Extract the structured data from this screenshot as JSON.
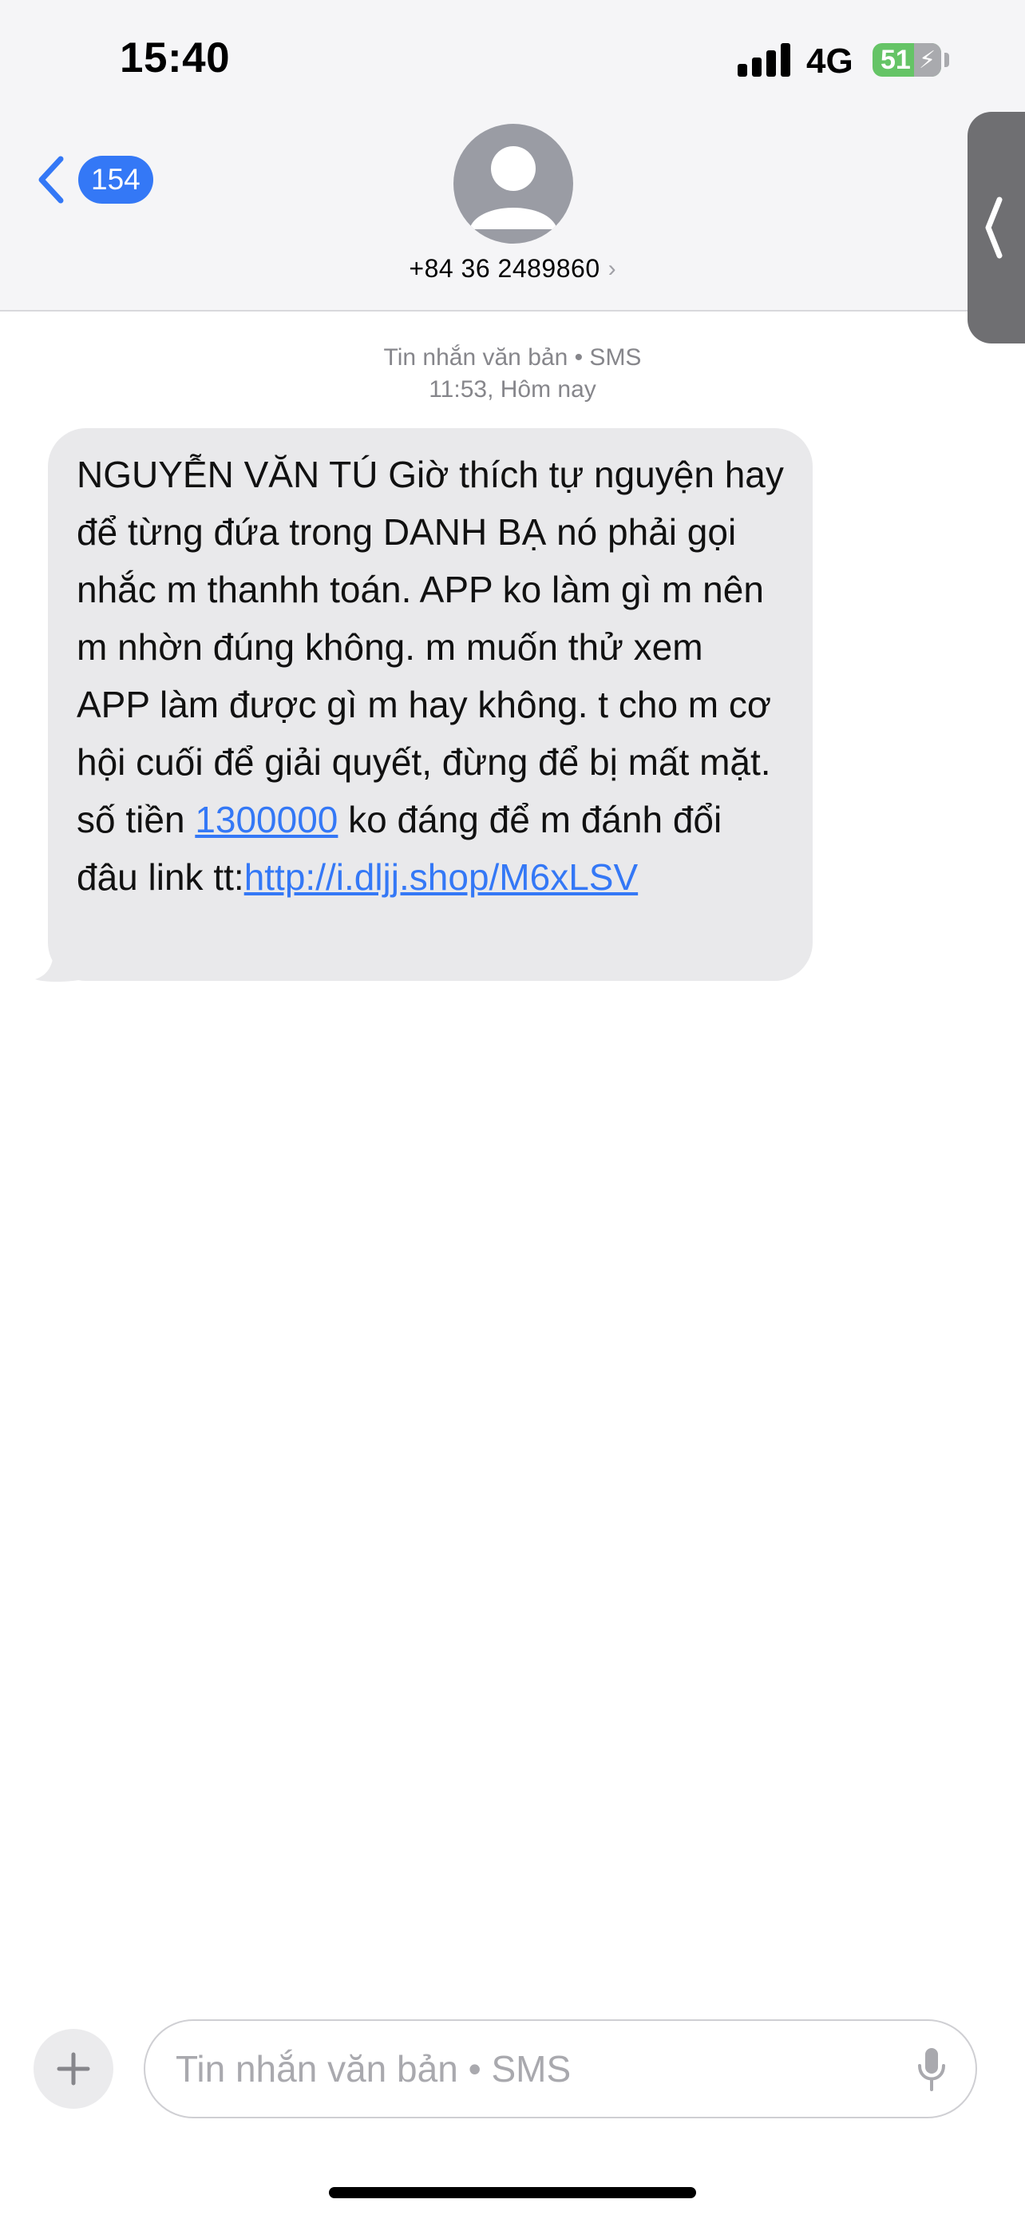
{
  "status_bar": {
    "time": "15:40",
    "network": "4G",
    "battery_percent": "51",
    "battery_charging": true
  },
  "nav": {
    "back_count": "154",
    "contact_number": "+84 36 2489860",
    "avatar_icon": "person-silhouette-icon"
  },
  "conversation": {
    "meta_type": "Tin nhắn văn bản • SMS",
    "meta_time": "11:53, Hôm nay",
    "message": {
      "part1": "NGUYỄN VĂN TÚ  Giờ thích tự nguyện hay để từng đứa trong DANH BẠ nó phải gọi nhắc m thanhh toán. APP ko làm gì m nên m nhờn đúng không. m muốn thử xem APP làm được gì m hay không. t cho m cơ hội cuối để giải quyết, đừng để bị mất mặt. số tiền ",
      "amount_link": "1300000",
      "part2": " ko đáng để m đánh đổi đâu link tt:",
      "url_link": "http://i.dljj.shop/M6xLSV"
    }
  },
  "composer": {
    "placeholder": "Tin nhắn văn bản • SMS"
  },
  "colors": {
    "accent_blue": "#3478f6",
    "bubble_gray": "#e9e9eb",
    "battery_green": "#65c466"
  }
}
